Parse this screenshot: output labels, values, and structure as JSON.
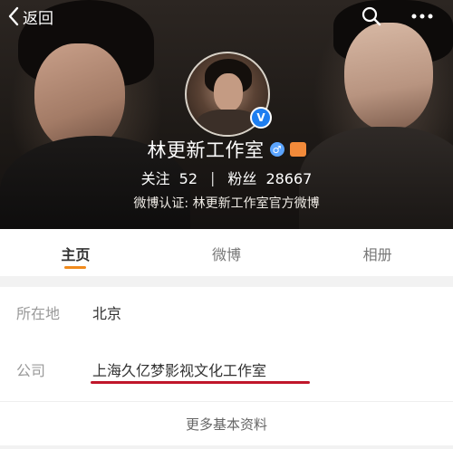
{
  "nav": {
    "back_label": "返回"
  },
  "profile": {
    "name": "林更新工作室",
    "following_label": "关注",
    "following_count": "52",
    "followers_label": "粉丝",
    "followers_count": "28667",
    "verification": "微博认证: 林更新工作室官方微博",
    "verified_badge": "V",
    "gender_symbol": "♂"
  },
  "tabs": [
    {
      "label": "主页",
      "active": true
    },
    {
      "label": "微博",
      "active": false
    },
    {
      "label": "相册",
      "active": false
    }
  ],
  "info": {
    "location_label": "所在地",
    "location_value": "北京",
    "company_label": "公司",
    "company_value": "上海久亿梦影视文化工作室",
    "more_label": "更多基本资料"
  },
  "colors": {
    "tab_indicator": "#f08a1c",
    "verified_blue": "#1e7ef0",
    "annotation_red": "#c0162a"
  }
}
